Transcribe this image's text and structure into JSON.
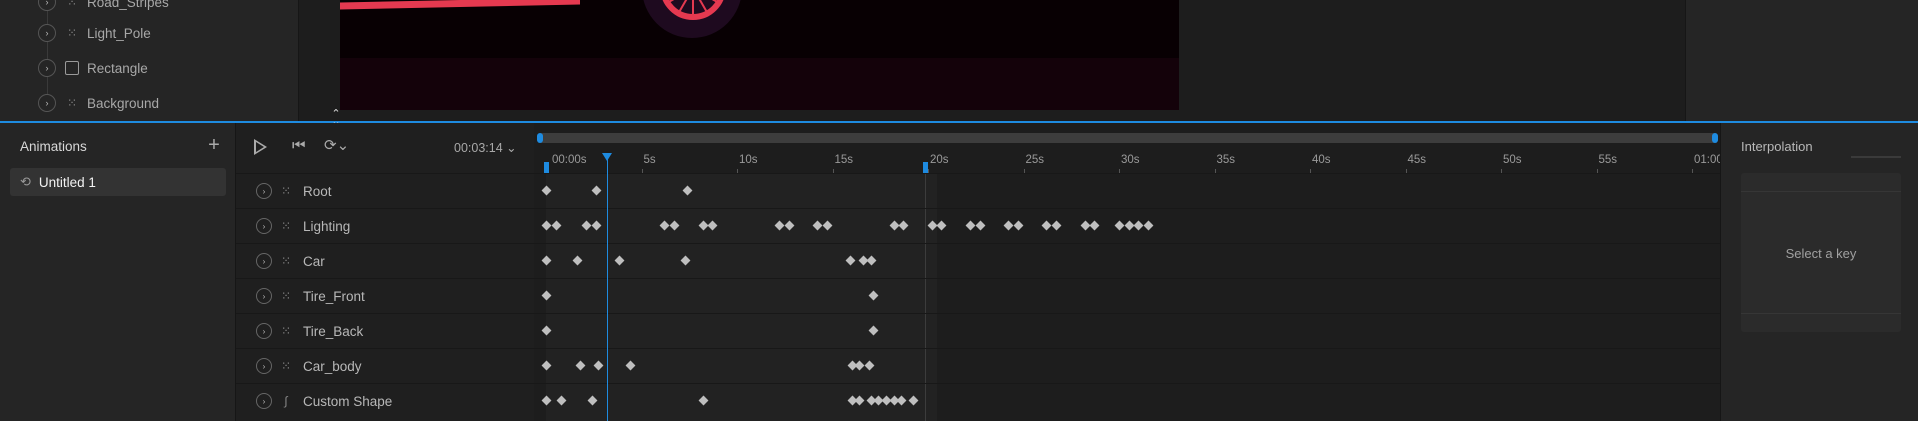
{
  "hierarchy": {
    "items": [
      {
        "label": "Road_Stripes",
        "kind": "group"
      },
      {
        "label": "Light_Pole",
        "kind": "group"
      },
      {
        "label": "Rectangle",
        "kind": "rect"
      },
      {
        "label": "Background",
        "kind": "group"
      }
    ]
  },
  "animations": {
    "title": "Animations",
    "add_icon": "plus-icon",
    "items": [
      {
        "label": "Untitled 1",
        "icon": "animation-icon"
      }
    ]
  },
  "timeline": {
    "timecode": "00:03:14",
    "play_icon": "play-icon",
    "rewind_icon": "skip-back-icon",
    "loop_icon": "loop-icon",
    "ticks": [
      "00:00s",
      "5s",
      "10s",
      "15s",
      "20s",
      "25s",
      "30s",
      "35s",
      "40s",
      "45s",
      "50s",
      "55s",
      "01:00"
    ],
    "playhead_seconds": 3.2,
    "work_end_seconds": 20,
    "layers": [
      {
        "label": "Root",
        "kind": "group",
        "keys": [
          0,
          2.6,
          7.4
        ]
      },
      {
        "label": "Lighting",
        "kind": "group",
        "keys": [
          0,
          0.5,
          2.1,
          2.6,
          6.2,
          6.7,
          8.2,
          8.7,
          12.2,
          12.7,
          14.2,
          14.7,
          18.2,
          18.7,
          20.2,
          20.7,
          22.2,
          22.7,
          24.2,
          24.7,
          26.2,
          26.7,
          28.2,
          28.7,
          30.0,
          30.5,
          31.0,
          31.5
        ]
      },
      {
        "label": "Car",
        "kind": "group",
        "keys": [
          0,
          1.6,
          3.8,
          7.3,
          15.9,
          16.6,
          17.0
        ]
      },
      {
        "label": "Tire_Front",
        "kind": "group",
        "keys": [
          0,
          17.1
        ]
      },
      {
        "label": "Tire_Back",
        "kind": "group",
        "keys": [
          0,
          17.1
        ]
      },
      {
        "label": "Car_body",
        "kind": "group",
        "keys": [
          0,
          1.8,
          2.7,
          4.4,
          16.0,
          16.4,
          16.9
        ]
      },
      {
        "label": "Custom Shape",
        "kind": "path",
        "keys": [
          0,
          0.8,
          2.4,
          8.2,
          16.0,
          16.4,
          17.0,
          17.4,
          17.8,
          18.2,
          18.6,
          19.2
        ]
      }
    ]
  },
  "interpolation": {
    "title": "Interpolation",
    "empty_message": "Select a key"
  },
  "colors": {
    "accent": "#1e8be0",
    "stage_red": "#e53950"
  }
}
